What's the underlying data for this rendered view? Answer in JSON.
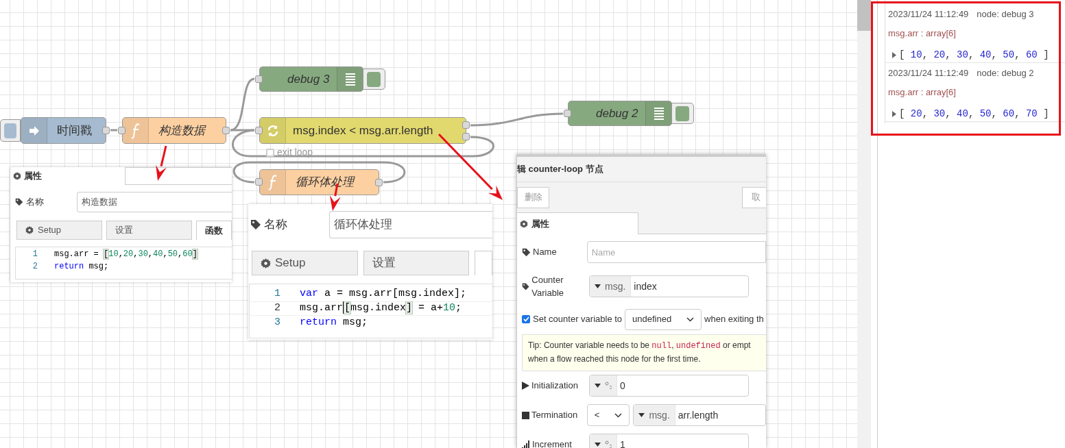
{
  "nodes": [
    {
      "kind": "inject",
      "label": "时间戳"
    },
    {
      "kind": "function",
      "label": "构造数据"
    },
    {
      "kind": "debug",
      "label": "debug 3"
    },
    {
      "kind": "loop",
      "label": "msg.index < msg.arr.length",
      "exit_label": "exit loop"
    },
    {
      "kind": "function",
      "label": "循环体处理"
    },
    {
      "kind": "debug",
      "label": "debug 2"
    }
  ],
  "function_panel_1": {
    "tab": "属性",
    "name_label": "名称",
    "name_value": "构造数据",
    "tabs": [
      {
        "kind": "gear",
        "label": "Setup",
        "selected": false
      },
      {
        "kind": "plain",
        "label": "设置",
        "selected": false
      },
      {
        "kind": "plain",
        "label": "函数",
        "selected": true
      }
    ],
    "code": [
      {
        "number": "1",
        "active": false,
        "tokens": [
          {
            "kind": "plain",
            "t": "msg.arr = "
          },
          {
            "kind": "bracket",
            "t": "["
          },
          {
            "kind": "number",
            "t": "10"
          },
          {
            "kind": "plain",
            "t": ","
          },
          {
            "kind": "number",
            "t": "20"
          },
          {
            "kind": "plain",
            "t": ","
          },
          {
            "kind": "number",
            "t": "30"
          },
          {
            "kind": "plain",
            "t": ","
          },
          {
            "kind": "number",
            "t": "40"
          },
          {
            "kind": "plain",
            "t": ","
          },
          {
            "kind": "number",
            "t": "50"
          },
          {
            "kind": "plain",
            "t": ","
          },
          {
            "kind": "number",
            "t": "60"
          },
          {
            "kind": "bracket",
            "t": "]"
          }
        ]
      },
      {
        "number": "2",
        "active": false,
        "tokens": [
          {
            "kind": "keyword",
            "t": "return"
          },
          {
            "kind": "plain",
            "t": " msg;"
          }
        ]
      }
    ]
  },
  "function_panel_2": {
    "name_label": "名称",
    "name_value": "循环体处理",
    "tabs": [
      {
        "kind": "gear",
        "label": "Setup",
        "selected": false
      },
      {
        "kind": "plain",
        "label": "设置",
        "selected": false
      },
      {
        "kind": "plain",
        "selected": true
      }
    ],
    "code": [
      {
        "number": "1",
        "active": false,
        "tokens": [
          {
            "kind": "keyword",
            "t": "var"
          },
          {
            "kind": "plain",
            "t": " a = msg.arr[msg.index];"
          }
        ]
      },
      {
        "number": "2",
        "active": true,
        "tokens": [
          {
            "kind": "plain",
            "t": "msg.arr"
          },
          {
            "kind": "cursor"
          },
          {
            "kind": "bracket",
            "t": "["
          },
          {
            "kind": "plain",
            "t": "msg.index"
          },
          {
            "kind": "bracket",
            "t": "]"
          },
          {
            "kind": "plain",
            "t": " = a+"
          },
          {
            "kind": "number",
            "t": "10"
          },
          {
            "kind": "plain",
            "t": ";"
          }
        ]
      },
      {
        "number": "3",
        "active": false,
        "tokens": [
          {
            "kind": "keyword",
            "t": "return"
          },
          {
            "kind": "plain",
            "t": " msg;"
          }
        ]
      }
    ]
  },
  "edit_panel": {
    "title": "辑 counter-loop 节点",
    "delete_button": "删除",
    "cancel_button": "取",
    "tab": "属性",
    "name": {
      "label": "Name",
      "placeholder": "Name"
    },
    "counter": {
      "label": "Counter Variable",
      "prefix": "msg.",
      "value": "index"
    },
    "set_counter": {
      "checked": true,
      "label": "Set counter variable to",
      "select": "undefined",
      "after": "when exiting th"
    },
    "tip": [
      {
        "kind": "text",
        "t": "Tip: Counter variable needs to be "
      },
      {
        "kind": "code",
        "t": "null"
      },
      {
        "kind": "text",
        "t": ", "
      },
      {
        "kind": "code",
        "t": "undefined"
      },
      {
        "kind": "text",
        "t": " or empt"
      },
      {
        "kind": "line",
        "t": "when a flow reached this node for the first time."
      }
    ],
    "initialization": {
      "label": "Initialization",
      "value": "0"
    },
    "termination": {
      "label": "Termination",
      "operator": "<",
      "prefix": "msg.",
      "value": "arr.length"
    },
    "increment": {
      "label": "Increment",
      "value": "1"
    }
  },
  "debug_messages": [
    {
      "time": "2023/11/24 11:12:49",
      "node": "node: debug 3",
      "path": "msg.arr : array[6]",
      "tokens": [
        {
          "kind": "plain",
          "t": "[ "
        },
        {
          "kind": "number",
          "t": "10"
        },
        {
          "kind": "plain",
          "t": ", "
        },
        {
          "kind": "number",
          "t": "20"
        },
        {
          "kind": "plain",
          "t": ", "
        },
        {
          "kind": "number",
          "t": "30"
        },
        {
          "kind": "plain",
          "t": ", "
        },
        {
          "kind": "number",
          "t": "40"
        },
        {
          "kind": "plain",
          "t": ", "
        },
        {
          "kind": "number",
          "t": "50"
        },
        {
          "kind": "plain",
          "t": ", "
        },
        {
          "kind": "number",
          "t": "60"
        },
        {
          "kind": "plain",
          "t": " ]"
        }
      ]
    },
    {
      "time": "2023/11/24 11:12:49",
      "node": "node: debug 2",
      "path": "msg.arr : array[6]",
      "tokens": [
        {
          "kind": "plain",
          "t": "[ "
        },
        {
          "kind": "number",
          "t": "20"
        },
        {
          "kind": "plain",
          "t": ", "
        },
        {
          "kind": "number",
          "t": "30"
        },
        {
          "kind": "plain",
          "t": ", "
        },
        {
          "kind": "number",
          "t": "40"
        },
        {
          "kind": "plain",
          "t": ", "
        },
        {
          "kind": "number",
          "t": "50"
        },
        {
          "kind": "plain",
          "t": ", "
        },
        {
          "kind": "number",
          "t": "60"
        },
        {
          "kind": "plain",
          "t": ", "
        },
        {
          "kind": "number",
          "t": "70"
        },
        {
          "kind": "plain",
          "t": " ]"
        }
      ]
    }
  ]
}
